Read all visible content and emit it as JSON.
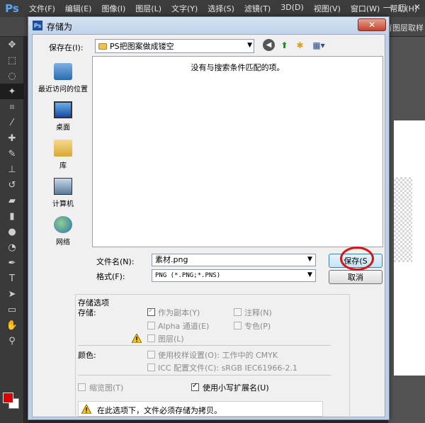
{
  "ps": {
    "logo": "Ps",
    "menu": [
      "文件(F)",
      "编辑(E)",
      "图像(I)",
      "图层(L)",
      "文字(Y)",
      "选择(S)",
      "滤镜(T)",
      "3D(D)",
      "视图(V)",
      "窗口(W)",
      "帮助(H)"
    ],
    "options_text": "有图层取样",
    "minimize": "—",
    "restore": "□",
    "close": "✕"
  },
  "dialog": {
    "title": "存储为",
    "title_icon": "Ps",
    "close": "✕",
    "save_in_label": "保存在(I):",
    "save_in_value": "PS把图案做成镂空",
    "empty_message": "没有与搜索条件匹配的项。",
    "places": [
      "最近访问的位置",
      "桌面",
      "库",
      "计算机",
      "网络"
    ],
    "filename_label": "文件名(N):",
    "filename_value": "素材.png",
    "format_label": "格式(F):",
    "format_value": "PNG (*.PNG;*.PNS)",
    "save_button": "保存(S",
    "cancel_button": "取消",
    "options": {
      "group_title": "存储选项",
      "save_label": "存储:",
      "as_copy": "作为副本(Y)",
      "notes": "注释(N)",
      "alpha": "Alpha 通道(E)",
      "spot": "专色(P)",
      "layers": "图层(L)",
      "color_label": "颜色:",
      "use_proof": "使用校样设置(O): 工作中的 CMYK",
      "icc": "ICC 配置文件(C): sRGB IEC61966-2.1",
      "thumbnail": "缩览图(T)",
      "lowercase_ext": "使用小写扩展名(U)",
      "warning": "在此选项下，文件必须存储为拷贝。"
    }
  },
  "colors": {
    "accent": "#3c7fb1",
    "annotation_circle": "#d21818",
    "foreground": "#e00000"
  }
}
